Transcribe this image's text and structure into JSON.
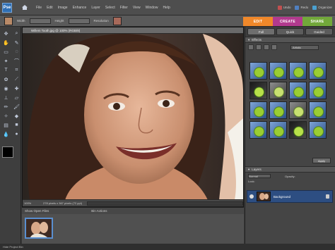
{
  "app": {
    "logo_text": "Pse",
    "menu": [
      "File",
      "Edit",
      "Image",
      "Enhance",
      "Layer",
      "Select",
      "Filter",
      "View",
      "Window",
      "Help"
    ],
    "right_links": [
      {
        "label": "Undo",
        "color": "#c05050"
      },
      {
        "label": "Redo",
        "color": "#5080c0"
      },
      {
        "label": "Organizer",
        "color": "#4aa0d0"
      }
    ]
  },
  "options": {
    "labels": [
      "Width",
      "Height",
      "Resolution"
    ]
  },
  "modes": {
    "edit": "EDIT",
    "create": "CREATE",
    "share": "SHARE"
  },
  "document": {
    "tab_title": "Willem Tooth.jpg @ 100% (RGB/8)",
    "zoom": "100%",
    "status_info": "278 pixels x 367 pixels (72 ppi)"
  },
  "project_bin": {
    "title": "Show Open Files",
    "bin_actions": "Bin Actions"
  },
  "status_bar": {
    "label": "Hide Project Bin"
  },
  "panels": {
    "tabs": [
      "Full",
      "Quick",
      "Guided"
    ],
    "effects_title": "Effects",
    "effects_select": "Artistic",
    "apply_label": "Apply",
    "layers_title": "Layers",
    "blend_mode": "Normal",
    "opacity_label": "Opacity:",
    "lock_label": "Lock:",
    "layer_name": "Background"
  }
}
